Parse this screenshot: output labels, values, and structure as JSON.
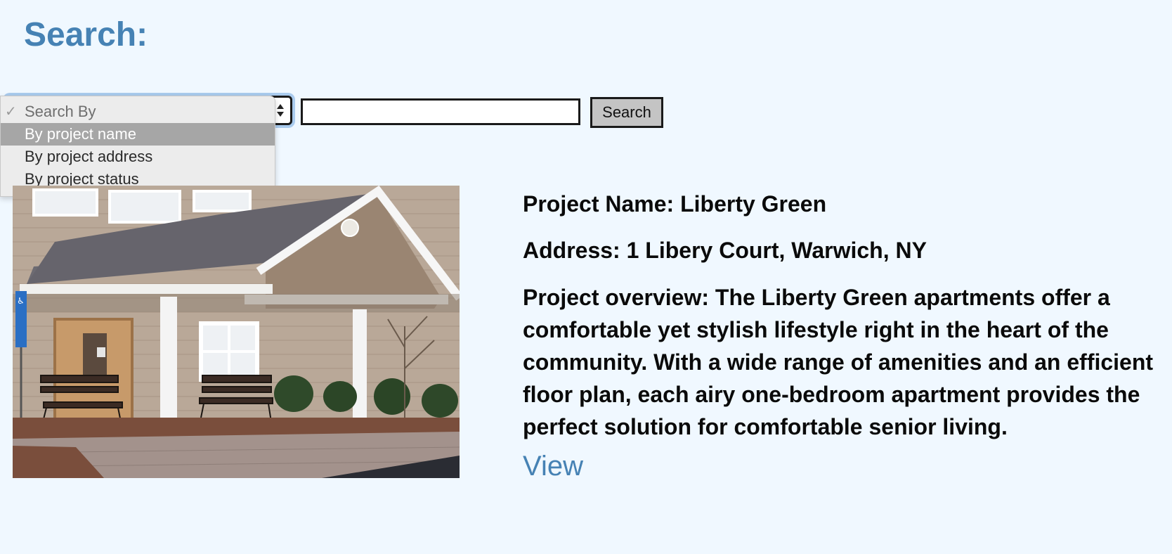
{
  "header": {
    "title": "Search:"
  },
  "search": {
    "select_options": [
      {
        "label": "Search By",
        "is_header": true,
        "checked": true
      },
      {
        "label": "By project name",
        "highlighted": true
      },
      {
        "label": "By project address"
      },
      {
        "label": "By project status"
      }
    ],
    "input_value": "",
    "button_label": "Search"
  },
  "project": {
    "name_line": "Project Name: Liberty Green",
    "address_line": "Address: 1 Libery Court, Warwich, NY",
    "overview_line": "Project overview: The Liberty Green apartments offer a comfortable yet stylish lifestyle right in the heart of the community. With a wide range of amenities and an efficient floor plan, each airy one-bedroom apartment provides the perfect solution for comfortable senior living.",
    "view_label": "View"
  },
  "icons": {
    "check": "check-icon",
    "select_arrows": "select-arrows-icon",
    "accessibility_sign": "accessibility-sign-icon"
  },
  "colors": {
    "page_background": "#f0f8ff",
    "accent": "#4682b4",
    "highlight_option": "#a6a6a6",
    "button_background": "#c4c4c4"
  }
}
